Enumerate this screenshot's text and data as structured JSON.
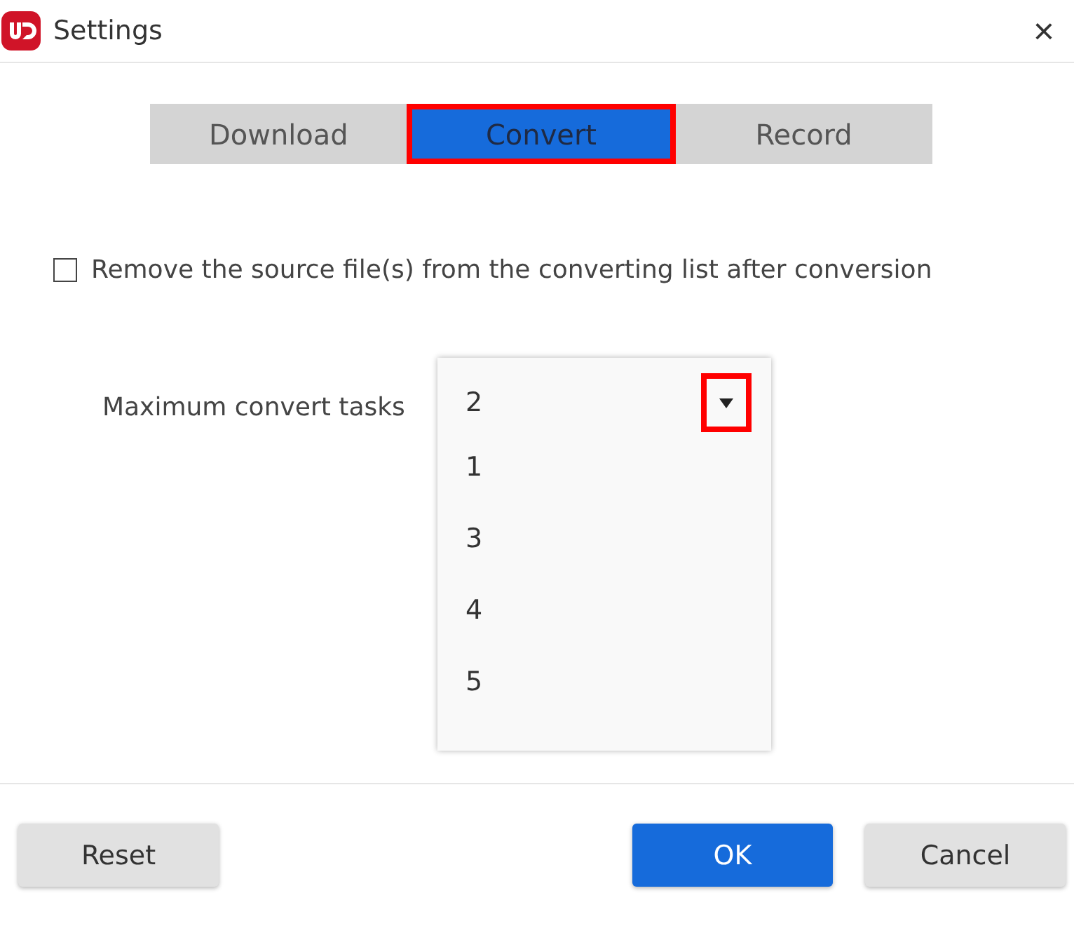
{
  "window": {
    "title": "Settings",
    "close": "×"
  },
  "tabs": [
    {
      "label": "Download",
      "selected": false,
      "highlighted": false
    },
    {
      "label": "Convert",
      "selected": true,
      "highlighted": true
    },
    {
      "label": "Record",
      "selected": false,
      "highlighted": false
    }
  ],
  "remove_source": {
    "label": "Remove the source file(s) from the converting list after conversion",
    "checked": false
  },
  "max_tasks": {
    "label": "Maximum convert tasks",
    "value": "2",
    "expanded": true,
    "arrow_highlighted": true,
    "options": [
      {
        "label": "1",
        "selected": false
      },
      {
        "label": "3",
        "selected": false
      },
      {
        "label": "4",
        "selected": false
      },
      {
        "label": "5",
        "selected": false
      }
    ]
  },
  "buttons": [
    {
      "label": "Reset",
      "kind": "secondary"
    },
    {
      "label": "OK",
      "kind": "primary"
    },
    {
      "label": "Cancel",
      "kind": "secondary"
    }
  ]
}
